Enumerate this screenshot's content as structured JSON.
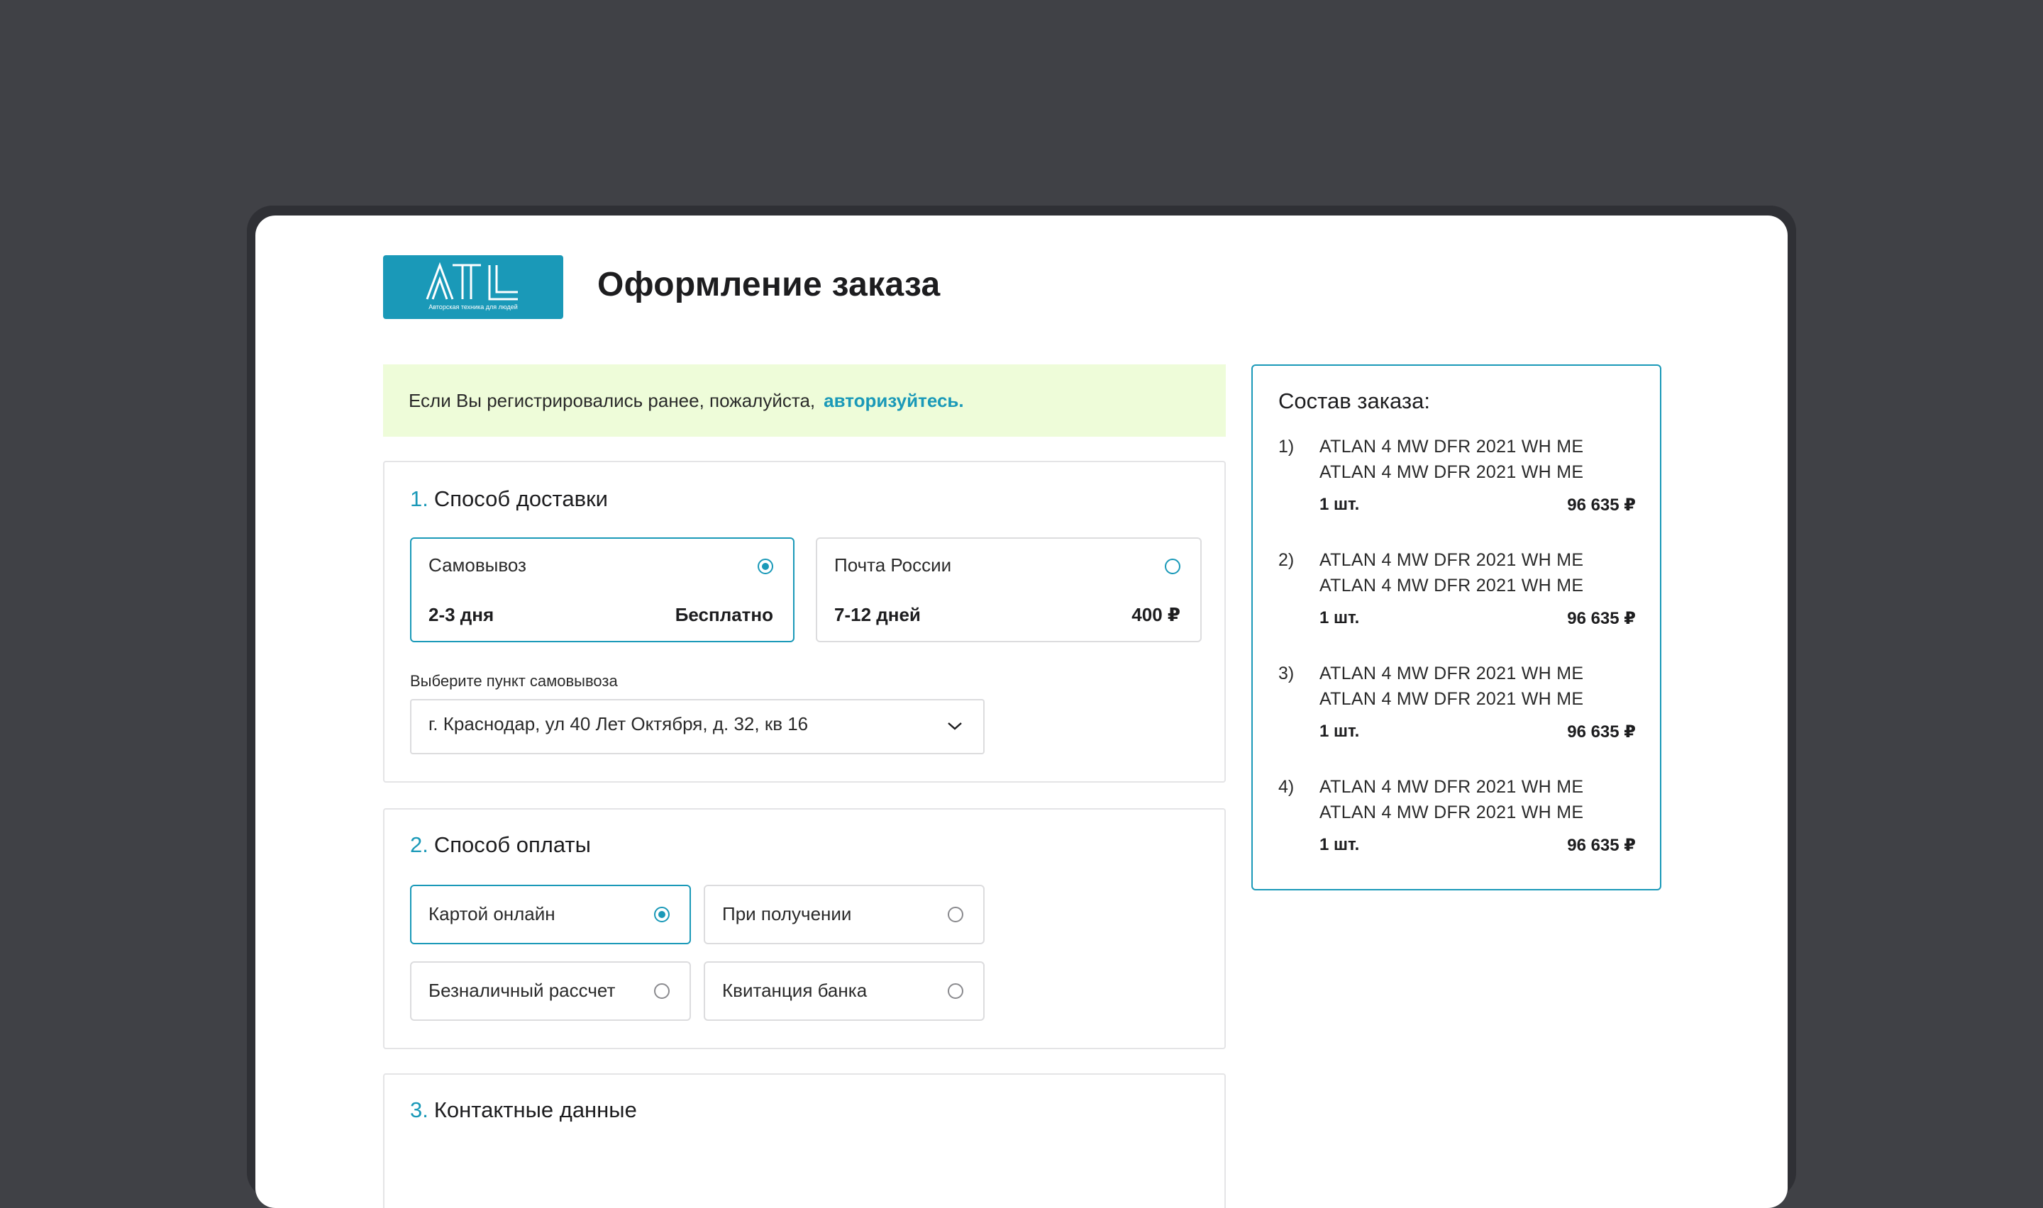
{
  "brand": {
    "logo_text": "ATL",
    "logo_tagline": "Авторская техника для людей",
    "accent_color": "#1a99b8"
  },
  "header": {
    "title": "Оформление заказа"
  },
  "notice": {
    "text": "Если Вы регистрировались ранее, пожалуйста,",
    "link": "авторизуйтесь."
  },
  "delivery": {
    "number": "1.",
    "title": "Способ доставки",
    "options": [
      {
        "name": "Самовывоз",
        "time": "2-3 дня",
        "price": "Бесплатно",
        "selected": true
      },
      {
        "name": "Почта России",
        "time": "7-12 дней",
        "price": "400 ₽",
        "selected": false
      }
    ],
    "pickup_label": "Выберите пункт самовывоза",
    "pickup_value": "г. Краснодар, ул 40 Лет Октября, д. 32, кв 16"
  },
  "payment": {
    "number": "2.",
    "title": "Способ оплаты",
    "options": [
      {
        "name": "Картой онлайн",
        "selected": true
      },
      {
        "name": "При получении",
        "selected": false
      },
      {
        "name": "Безналичный рассчет",
        "selected": false
      },
      {
        "name": "Квитанция банка",
        "selected": false
      }
    ]
  },
  "contacts": {
    "number": "3.",
    "title": "Контактные данные"
  },
  "summary": {
    "title": "Состав заказа:",
    "items": [
      {
        "index": "1)",
        "line1": "ATLAN 4 MW DFR 2021 WH ME",
        "line2": "ATLAN 4 MW DFR 2021 WH ME",
        "qty": "1 шт.",
        "price": "96 635 ₽"
      },
      {
        "index": "2)",
        "line1": "ATLAN 4 MW DFR 2021 WH ME",
        "line2": "ATLAN 4 MW DFR 2021 WH ME",
        "qty": "1 шт.",
        "price": "96 635 ₽"
      },
      {
        "index": "3)",
        "line1": "ATLAN 4 MW DFR 2021 WH ME",
        "line2": "ATLAN 4 MW DFR 2021 WH ME",
        "qty": "1 шт.",
        "price": "96 635 ₽"
      },
      {
        "index": "4)",
        "line1": "ATLAN 4 MW DFR 2021 WH ME",
        "line2": "ATLAN 4 MW DFR 2021 WH ME",
        "qty": "1 шт.",
        "price": "96 635 ₽"
      }
    ]
  }
}
